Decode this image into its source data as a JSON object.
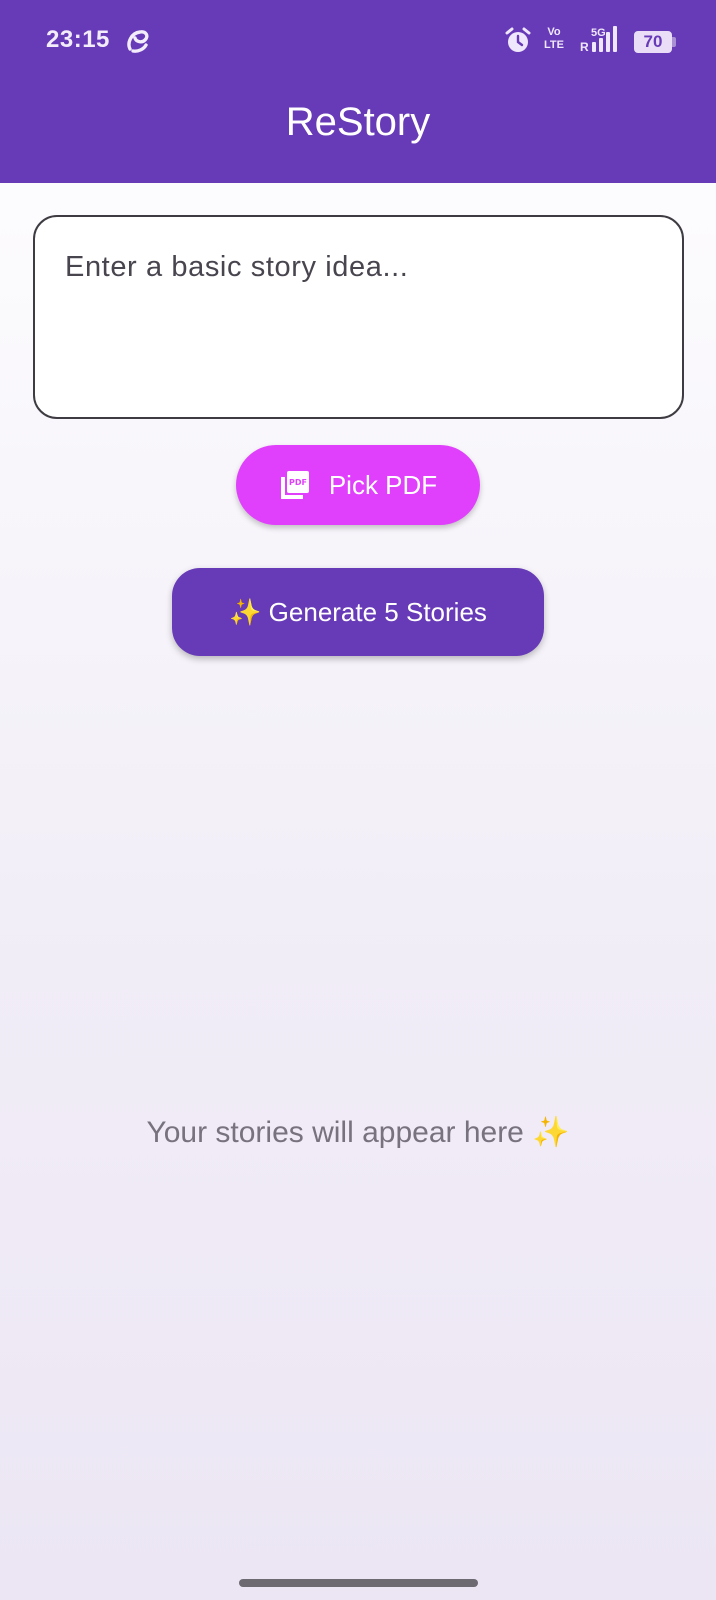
{
  "status_bar": {
    "time": "23:15",
    "network_top": "Vo",
    "network_bottom": "LTE",
    "signal_type": "5G",
    "roaming": "R",
    "battery": "70"
  },
  "app_bar": {
    "title": "ReStory"
  },
  "story_input": {
    "placeholder": "Enter a basic story idea...",
    "value": ""
  },
  "pick_pdf": {
    "label": "Pick PDF",
    "icon": "pdf-icon"
  },
  "generate": {
    "label": "✨ Generate 5 Stories"
  },
  "empty_state": {
    "message": "Your stories will appear here ✨"
  },
  "colors": {
    "primary": "#673ab7",
    "accent": "#e040fb"
  }
}
